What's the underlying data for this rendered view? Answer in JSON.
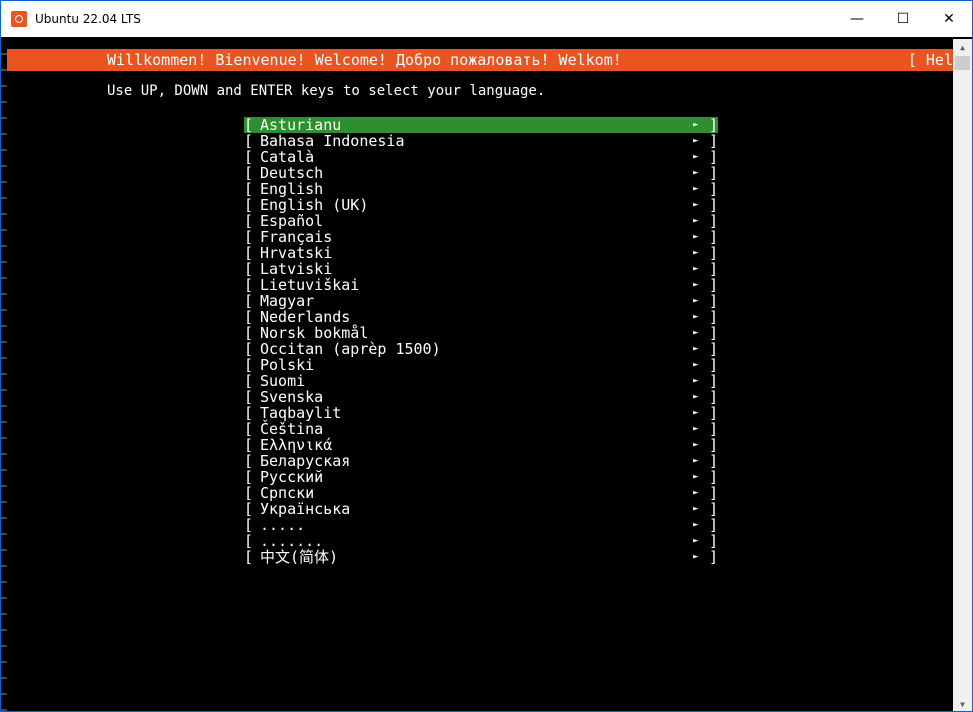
{
  "window": {
    "title": "Ubuntu 22.04 LTS",
    "controls": {
      "minimize": "—",
      "maximize": "☐",
      "close": "✕"
    }
  },
  "banner": {
    "text": "Willkommen! Bienvenue! Welcome! Добро пожаловать! Welkom!",
    "help": "[ Hel"
  },
  "instruction": "Use UP, DOWN and ENTER keys to select your language.",
  "menu": {
    "left_bracket": "[",
    "right_bracket": "]",
    "arrow": "►",
    "selected_index": 0,
    "items": [
      "Asturianu",
      "Bahasa Indonesia",
      "Català",
      "Deutsch",
      "English",
      "English (UK)",
      "Español",
      "Français",
      "Hrvatski",
      "Latviski",
      "Lietuviškai",
      "Magyar",
      "Nederlands",
      "Norsk bokmål",
      "Occitan (aprèp 1500)",
      "Polski",
      "Suomi",
      "Svenska",
      "Taqbaylit",
      "Čeština",
      "Ελληνικά",
      "Беларуская",
      "Русский",
      "Српски",
      "Українська",
      ".....",
      ".......",
      "中文(简体)"
    ]
  },
  "colors": {
    "banner_bg": "#e95420",
    "selected_bg": "#2d8f2d",
    "terminal_bg": "#000000",
    "text": "#ffffff"
  }
}
